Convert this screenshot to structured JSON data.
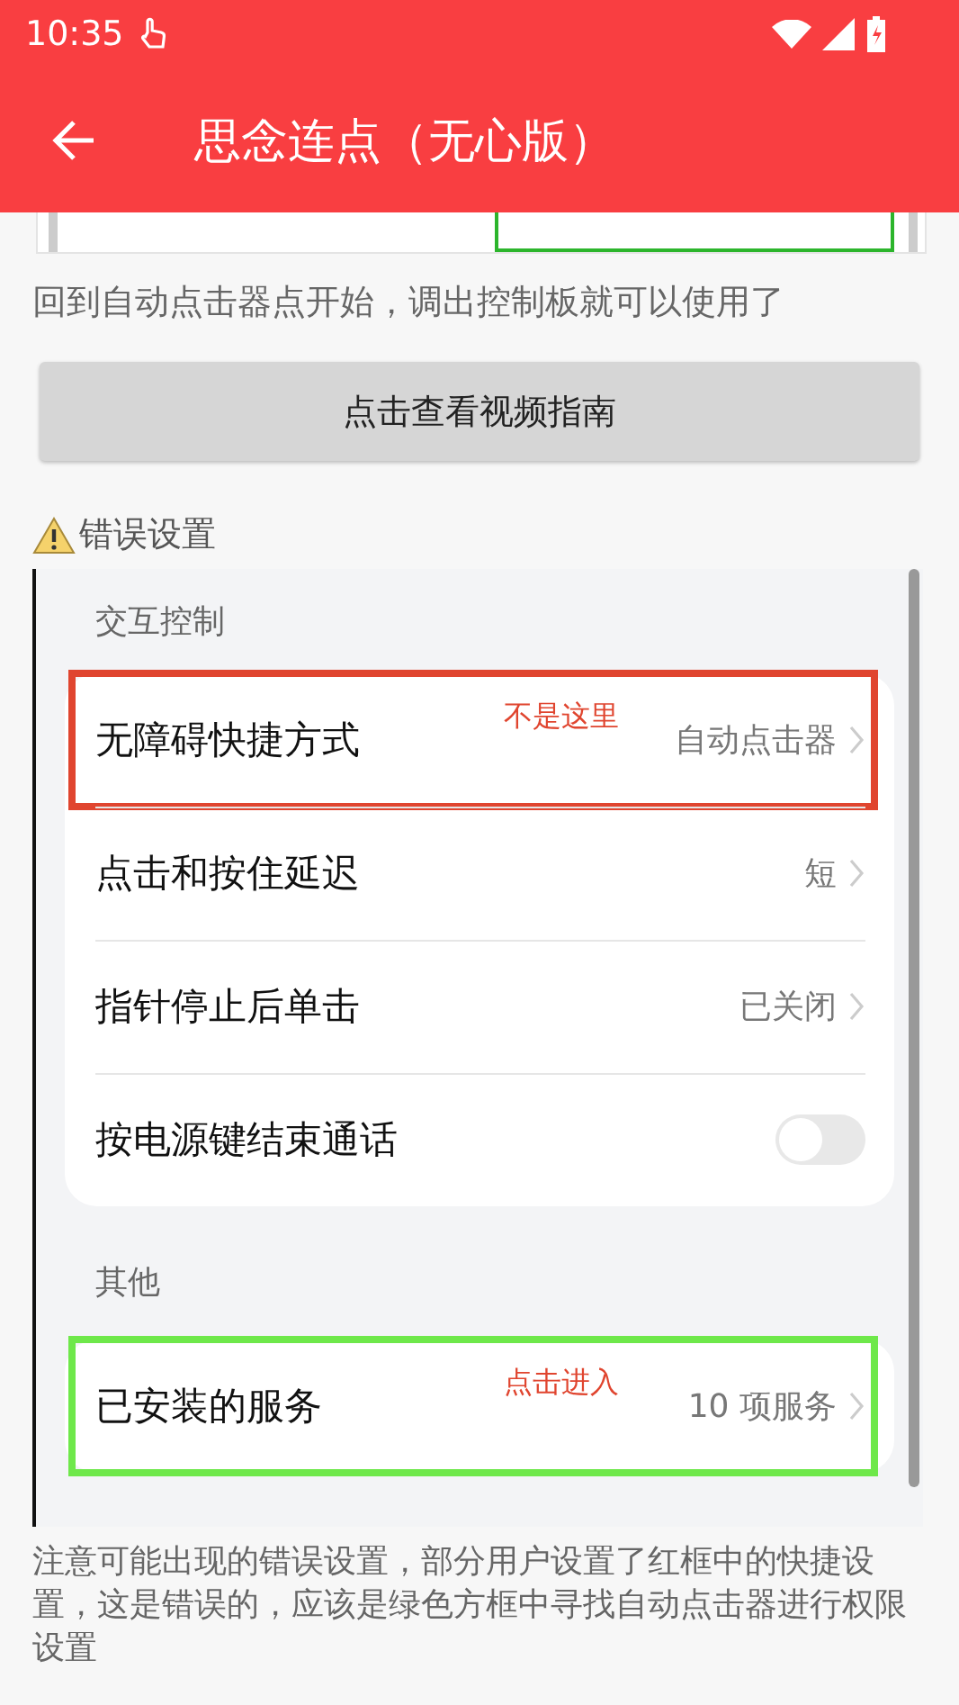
{
  "status_bar": {
    "time": "10:35"
  },
  "app_bar": {
    "title": "思念连点（无心版）"
  },
  "intro_text": "回到自动点击器点开始，调出控制板就可以使用了",
  "guide_button": "点击查看视频指南",
  "warning_title": "错误设置",
  "screenshot": {
    "sections": [
      {
        "title": "交互控制",
        "items": [
          {
            "kind": "link",
            "label": "无障碍快捷方式",
            "value": "自动点击器",
            "note": "不是这里",
            "color": "#e0452f"
          },
          {
            "kind": "link",
            "label": "点击和按住延迟",
            "value": "短"
          },
          {
            "kind": "link",
            "label": "指针停止后单击",
            "value": "已关闭"
          },
          {
            "kind": "toggle",
            "label": "按电源键结束通话",
            "on": false
          }
        ]
      },
      {
        "title": "其他",
        "items": [
          {
            "kind": "link",
            "label": "已安装的服务",
            "value": "10 项服务",
            "note": "点击进入",
            "color": "#6ee84a"
          }
        ]
      }
    ]
  },
  "caption": "注意可能出现的错误设置，部分用户设置了红框中的快捷设置，这是错误的，应该是绿色方框中寻找自动点击器进行权限设置"
}
